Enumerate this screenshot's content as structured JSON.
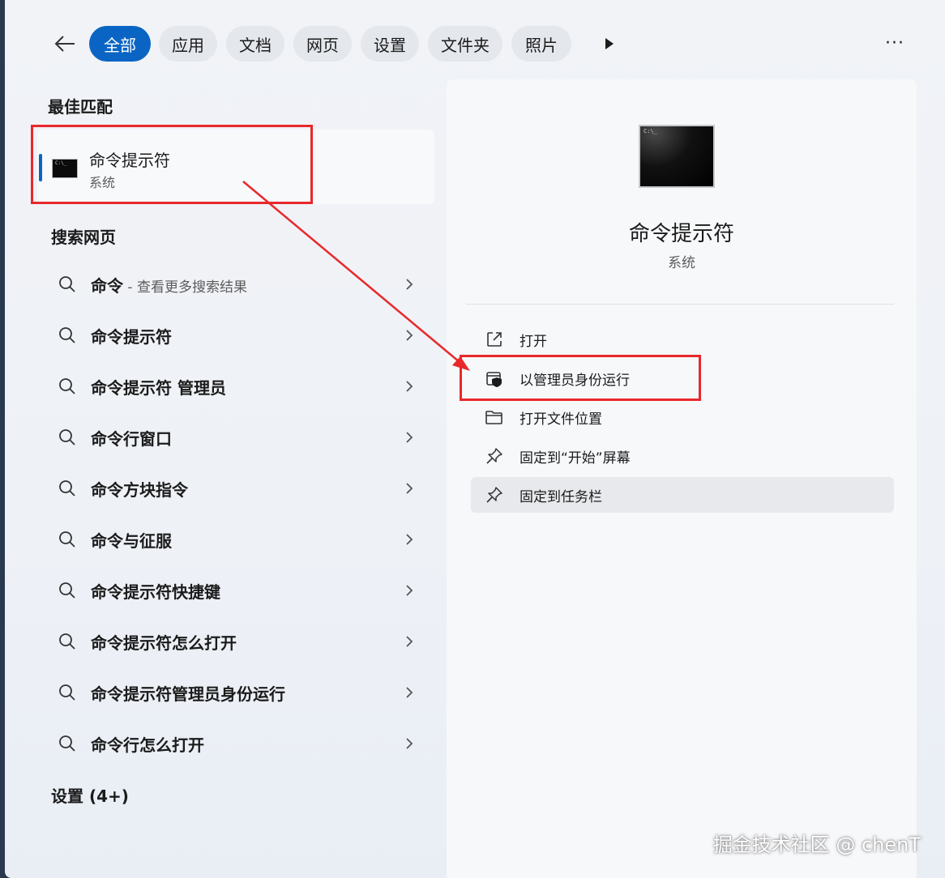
{
  "header": {
    "filters": [
      {
        "label": "全部",
        "active": true
      },
      {
        "label": "应用",
        "active": false
      },
      {
        "label": "文档",
        "active": false
      },
      {
        "label": "网页",
        "active": false
      },
      {
        "label": "设置",
        "active": false
      },
      {
        "label": "文件夹",
        "active": false
      },
      {
        "label": "照片",
        "active": false
      }
    ],
    "more_glyph": "···"
  },
  "best_match": {
    "section_title": "最佳匹配",
    "app_name": "命令提示符",
    "app_type": "系统",
    "icon": "command-prompt-icon"
  },
  "web_search": {
    "section_title": "搜索网页",
    "items": [
      {
        "text": "命令",
        "hint": " - 查看更多搜索结果"
      },
      {
        "text": "命令提示符",
        "hint": ""
      },
      {
        "text": "命令提示符 管理员",
        "hint": ""
      },
      {
        "text": "命令行窗口",
        "hint": ""
      },
      {
        "text": "命令方块指令",
        "hint": ""
      },
      {
        "text": "命令与征服",
        "hint": ""
      },
      {
        "text": "命令提示符快捷键",
        "hint": ""
      },
      {
        "text": "命令提示符怎么打开",
        "hint": ""
      },
      {
        "text": "命令提示符管理员身份运行",
        "hint": ""
      },
      {
        "text": "命令行怎么打开",
        "hint": ""
      }
    ]
  },
  "settings_section": {
    "title": "设置 (4+)"
  },
  "detail": {
    "app_name": "命令提示符",
    "app_type": "系统",
    "actions": [
      {
        "label": "打开",
        "icon": "open-external-icon"
      },
      {
        "label": "以管理员身份运行",
        "icon": "admin-shield-icon"
      },
      {
        "label": "打开文件位置",
        "icon": "folder-icon"
      },
      {
        "label": "固定到“开始”屏幕",
        "icon": "pin-icon"
      },
      {
        "label": "固定到任务栏",
        "icon": "pin-icon"
      }
    ]
  },
  "colors": {
    "accent": "#0a64c4",
    "annotation": "#e8282b"
  },
  "watermark": "掘金技术社区 @ chenT"
}
